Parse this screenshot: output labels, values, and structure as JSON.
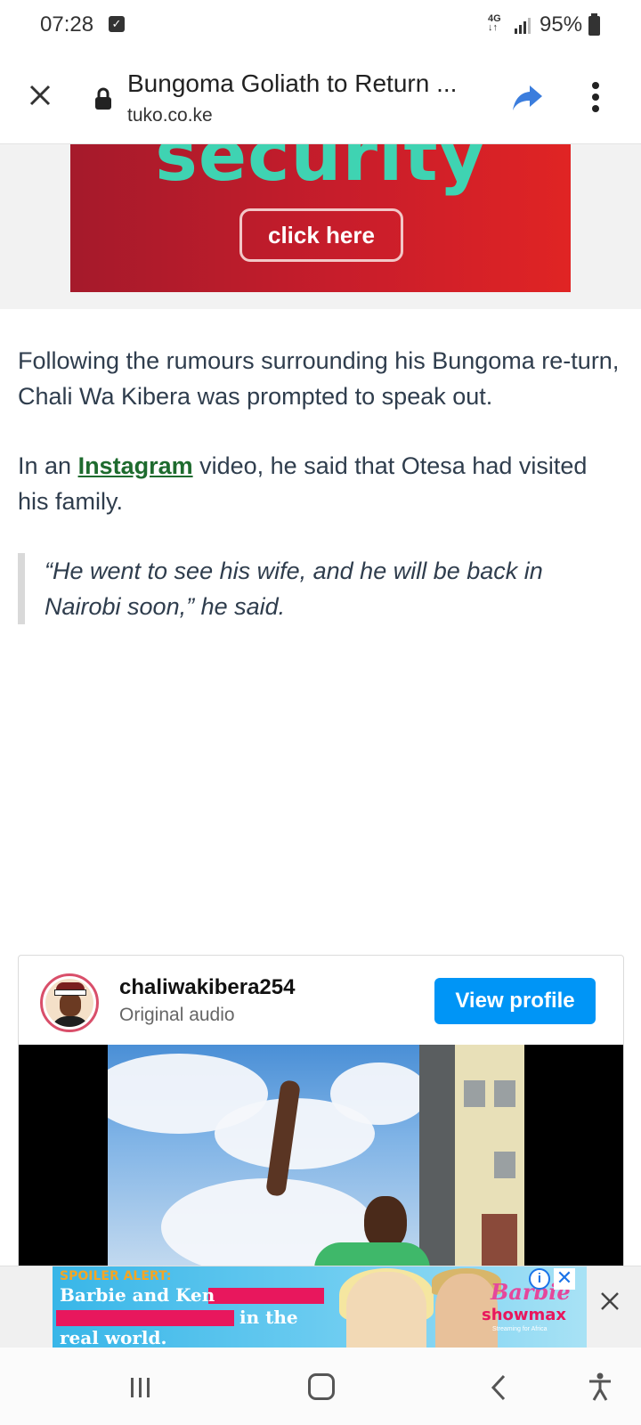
{
  "status_bar": {
    "time": "07:28",
    "network": "4G",
    "battery": "95%"
  },
  "browser": {
    "title": "Bungoma Goliath to Return ...",
    "url": "tuko.co.ke"
  },
  "top_ad": {
    "headline": "security",
    "button_label": "click here"
  },
  "article": {
    "paragraph1": "Following the rumours surrounding his Bungoma re-turn, Chali Wa Kibera was prompted to speak out.",
    "paragraph2_prefix": "In an ",
    "paragraph2_link": "Instagram",
    "paragraph2_suffix": " video, he said that Otesa had visited his family.",
    "quote": "“He went to see his wife, and he will be back in Nairobi soon,” he said."
  },
  "instagram_embed": {
    "username": "chaliwakibera254",
    "subtitle": "Original audio",
    "view_profile_label": "View profile"
  },
  "bottom_ad": {
    "spoiler": "SPOILER ALERT:",
    "line1": "Barbie and Ken",
    "line2": "in the",
    "line3": "real world.",
    "brand1": "Barbie",
    "brand2": "showmax",
    "brand2_tagline": "Streaming for Africa"
  },
  "colors": {
    "link_green": "#1e6b2e",
    "view_profile_blue": "#0095f6",
    "share_blue": "#3b7ddd",
    "ad_red": "#c81d2b",
    "ad_teal": "#3fd3b2"
  },
  "icons": {
    "close": "close-icon",
    "lock": "lock-icon",
    "share": "share-icon",
    "more": "more-vert-icon",
    "nav_recent": "recent-apps-icon",
    "nav_home": "home-icon",
    "nav_back": "back-icon",
    "nav_accessibility": "accessibility-icon"
  }
}
